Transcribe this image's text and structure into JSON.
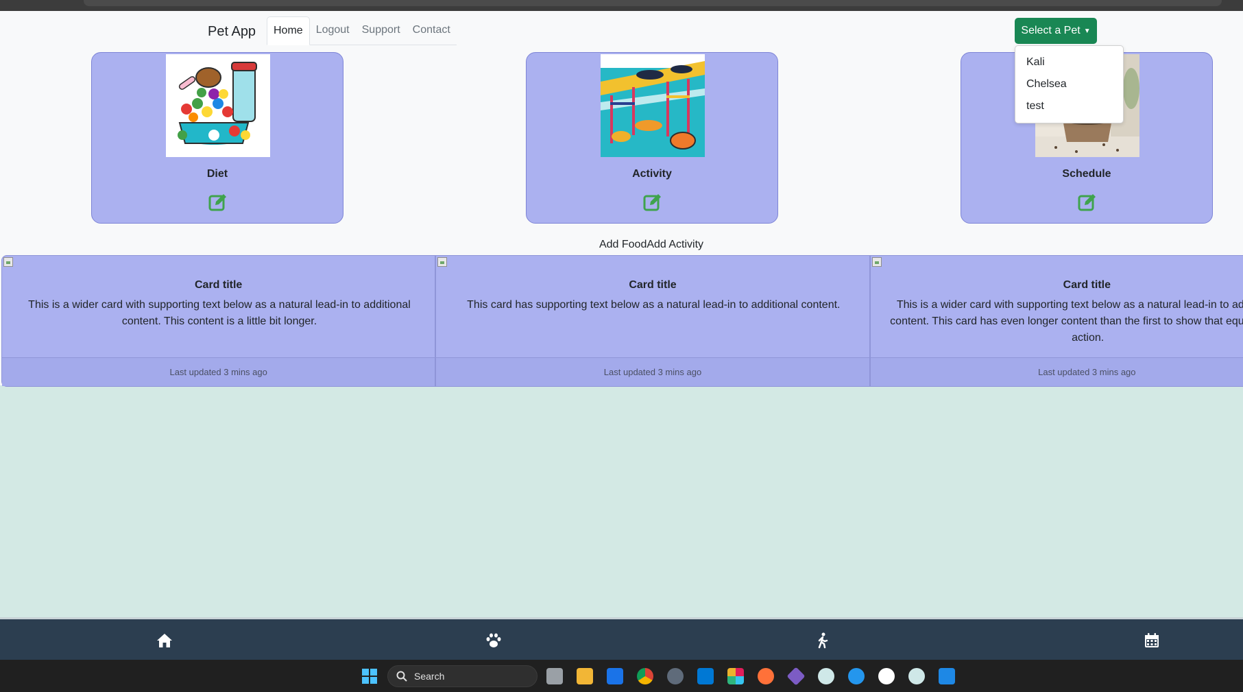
{
  "navbar": {
    "brand": "Pet App",
    "items": [
      {
        "label": "Home",
        "active": true
      },
      {
        "label": "Logout",
        "active": false
      },
      {
        "label": "Support",
        "active": false
      },
      {
        "label": "Contact",
        "active": false
      }
    ],
    "pet_select": "Select a Pet"
  },
  "dropdown": {
    "options": [
      "Kali",
      "Chelsea",
      "test"
    ]
  },
  "features": [
    {
      "title": "Diet",
      "icon": "edit-icon"
    },
    {
      "title": "Activity",
      "icon": "edit-icon"
    },
    {
      "title": "Schedule",
      "icon": "edit-icon"
    }
  ],
  "add_links": {
    "food": "Add Food",
    "activity": "Add Activity"
  },
  "cards": [
    {
      "title": "Card title",
      "text": "This is a wider card with supporting text below as a natural lead-in to additional content. This content is a little bit longer.",
      "footer": "Last updated 3 mins ago"
    },
    {
      "title": "Card title",
      "text": "This card has supporting text below as a natural lead-in to additional content.",
      "footer": "Last updated 3 mins ago"
    },
    {
      "title": "Card title",
      "text": "This is a wider card with supporting text below as a natural lead-in to additional content. This card has even longer content than the first to show that equal height action.",
      "footer": "Last updated 3 mins ago"
    }
  ],
  "bottom_nav": [
    "home-icon",
    "paw-icon",
    "walking-icon",
    "calendar-icon"
  ],
  "taskbar": {
    "search": "Search"
  },
  "colors": {
    "card_bg": "#abb1f0",
    "accent_green": "#198754",
    "edit_icon": "#3fa34d",
    "bottom_nav_bg": "#2c3e50",
    "page_bg": "#d3e9e4"
  }
}
